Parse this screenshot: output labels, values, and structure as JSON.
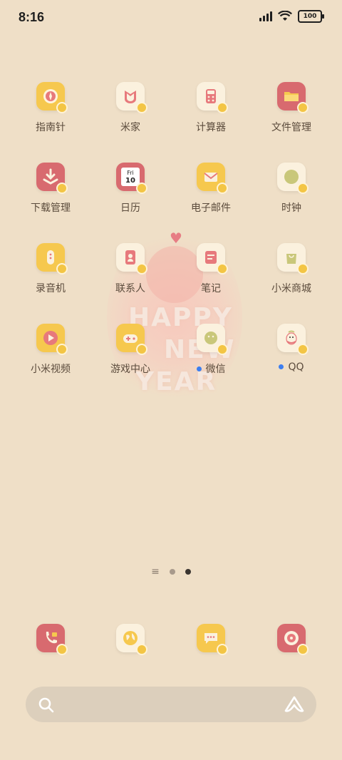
{
  "status_bar": {
    "time": "8:16",
    "battery": "100"
  },
  "apps": [
    {
      "label": "指南针",
      "icon": "compass-icon",
      "color": "yellow",
      "row": 0,
      "col": 0
    },
    {
      "label": "米家",
      "icon": "mi-home-icon",
      "color": "cream",
      "row": 0,
      "col": 1
    },
    {
      "label": "计算器",
      "icon": "calculator-icon",
      "color": "cream",
      "row": 0,
      "col": 2
    },
    {
      "label": "文件管理",
      "icon": "folder-icon",
      "color": "pink",
      "row": 0,
      "col": 3
    },
    {
      "label": "下载管理",
      "icon": "download-icon",
      "color": "pink",
      "row": 1,
      "col": 0
    },
    {
      "label": "日历",
      "icon": "calendar-icon",
      "color": "pink",
      "row": 1,
      "col": 1
    },
    {
      "label": "电子邮件",
      "icon": "email-icon",
      "color": "yellow",
      "row": 1,
      "col": 2
    },
    {
      "label": "时钟",
      "icon": "clock-icon",
      "color": "cream",
      "row": 1,
      "col": 3
    },
    {
      "label": "录音机",
      "icon": "recorder-icon",
      "color": "yellow",
      "row": 2,
      "col": 0
    },
    {
      "label": "联系人",
      "icon": "contacts-icon",
      "color": "cream",
      "row": 2,
      "col": 1
    },
    {
      "label": "笔记",
      "icon": "notes-icon",
      "color": "cream",
      "row": 2,
      "col": 2
    },
    {
      "label": "小米商城",
      "icon": "shopping-bag-icon",
      "color": "cream",
      "row": 2,
      "col": 3
    },
    {
      "label": "小米视频",
      "icon": "video-play-icon",
      "color": "yellow",
      "row": 3,
      "col": 0
    },
    {
      "label": "游戏中心",
      "icon": "gamepad-icon",
      "color": "yellow",
      "row": 3,
      "col": 1
    },
    {
      "label": "微信",
      "icon": "wechat-icon",
      "color": "cream",
      "row": 3,
      "col": 2,
      "dot": true
    },
    {
      "label": "QQ",
      "icon": "qq-penguin-icon",
      "color": "cream",
      "row": 3,
      "col": 3,
      "dot": true
    }
  ],
  "calendar": {
    "day": "Fri",
    "date": "10"
  },
  "wallpaper": {
    "line1": "HAPPY",
    "line2": "NEW",
    "line3": "YEAR"
  },
  "dock": [
    {
      "icon": "phone-icon",
      "color": "pink"
    },
    {
      "icon": "browser-globe-icon",
      "color": "cream"
    },
    {
      "icon": "messages-icon",
      "color": "yellow"
    },
    {
      "icon": "music-icon",
      "color": "pink"
    }
  ],
  "pager": {
    "pages": 2,
    "active": 1
  },
  "colors": {
    "background": "#efdfc7",
    "accent_yellow": "#f6c84e",
    "accent_pink": "#d86a6f",
    "dot_blue": "#3c7ef0"
  }
}
